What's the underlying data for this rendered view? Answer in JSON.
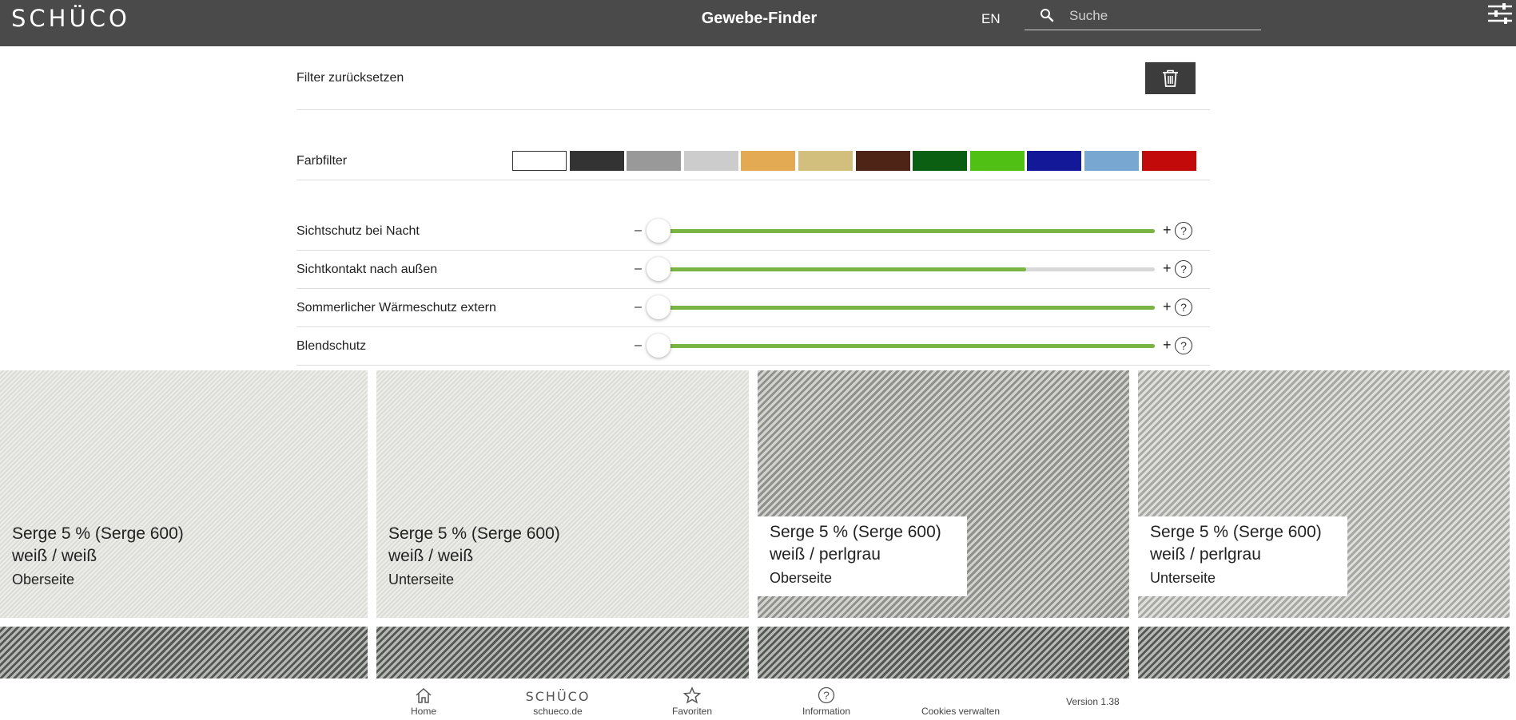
{
  "header": {
    "logo_text": "SCHÜCO",
    "title": "Gewebe-Finder",
    "language": "EN",
    "search_placeholder": "Suche",
    "search_icon": "search-icon",
    "menu_icon": "filter-menu-icon"
  },
  "filters": {
    "reset_label": "Filter zurücksetzen",
    "reset_icon": "trash-icon",
    "color_label": "Farbfilter",
    "colors": [
      "#ffffff",
      "#333333",
      "#999999",
      "#cccccc",
      "#e3a953",
      "#d2bf7e",
      "#4e2416",
      "#0a5f12",
      "#50c014",
      "#121898",
      "#78a8d2",
      "#c30a0a"
    ],
    "slider_minus": "–",
    "slider_plus": "+",
    "help_symbol": "?",
    "sliders": [
      {
        "label": "Sichtschutz bei Nacht",
        "value": 1.0
      },
      {
        "label": "Sichtkontakt nach außen",
        "value": 0.74
      },
      {
        "label": "Sommerlicher Wärmeschutz extern",
        "value": 1.0
      },
      {
        "label": "Blendschutz",
        "value": 1.0
      }
    ]
  },
  "fabrics": [
    {
      "name": "Serge 5 % (Serge 600)",
      "color": "weiß / weiß",
      "side": "Oberseite"
    },
    {
      "name": "Serge 5 % (Serge 600)",
      "color": "weiß / weiß",
      "side": "Unterseite"
    },
    {
      "name": "Serge 5 % (Serge 600)",
      "color": "weiß / perlgrau",
      "side": "Oberseite"
    },
    {
      "name": "Serge 5 % (Serge 600)",
      "color": "weiß / perlgrau",
      "side": "Unterseite"
    }
  ],
  "footer": {
    "home_label": "Home",
    "schueco_logo": "SCHÜCO",
    "schueco_label": "schueco.de",
    "favorites_label": "Favoriten",
    "information_label": "Information",
    "cookies_label": "Cookies verwalten",
    "version": "Version 1.38"
  }
}
